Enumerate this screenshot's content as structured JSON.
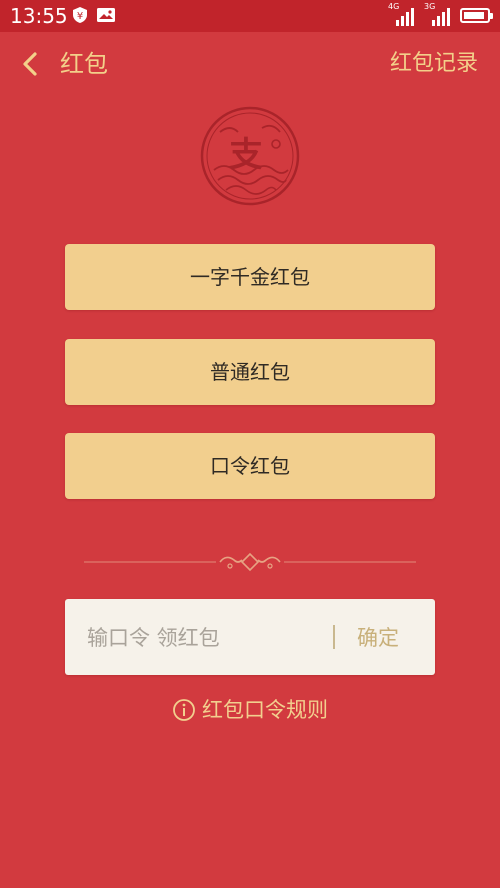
{
  "status_bar": {
    "time": "13:55",
    "signal1_label": "4G",
    "signal2_label": "3G",
    "battery_level": 0.9
  },
  "header": {
    "title": "红包",
    "record_label": "红包记录"
  },
  "logo_char": "支",
  "buttons": {
    "btn1": "一字千金红包",
    "btn2": "普通红包",
    "btn3": "口令红包"
  },
  "password_input": {
    "placeholder": "输口令 领红包",
    "value": "",
    "confirm_label": "确定"
  },
  "rules_label": "红包口令规则",
  "colors": {
    "background": "#D23A3F",
    "status_bar": "#C1242B",
    "accent_gold": "#F2CF8E",
    "input_bg": "#F6F2EA"
  }
}
